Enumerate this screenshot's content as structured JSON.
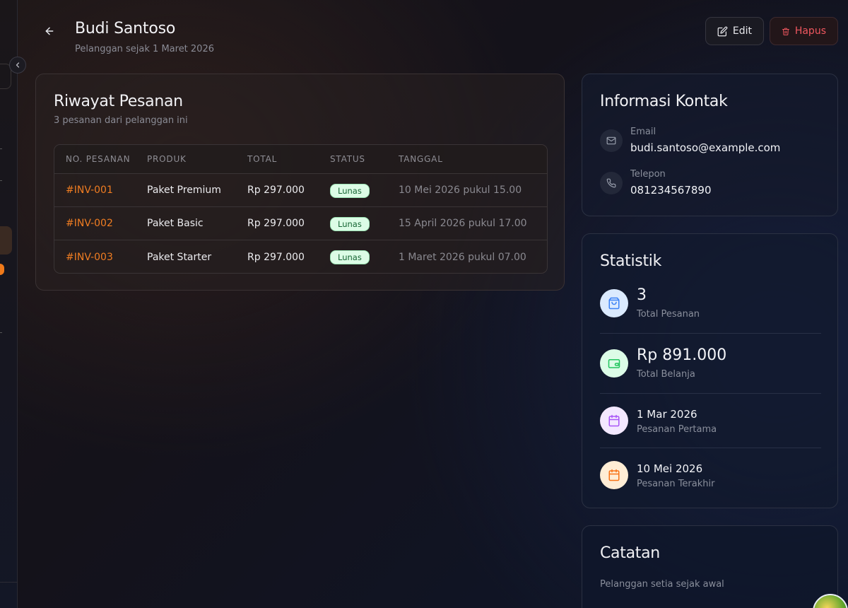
{
  "header": {
    "title": "Budi Santoso",
    "subtitle": "Pelanggan sejak 1 Maret 2026",
    "edit_label": "Edit",
    "delete_label": "Hapus"
  },
  "orders": {
    "title": "Riwayat Pesanan",
    "description": "3 pesanan dari pelanggan ini",
    "columns": [
      "NO. PESANAN",
      "PRODUK",
      "TOTAL",
      "STATUS",
      "TANGGAL"
    ],
    "rows": [
      {
        "id": "#INV-001",
        "product": "Paket Premium",
        "total": "Rp 297.000",
        "status": "Lunas",
        "date": "10 Mei 2026 pukul 15.00"
      },
      {
        "id": "#INV-002",
        "product": "Paket Basic",
        "total": "Rp 297.000",
        "status": "Lunas",
        "date": "15 April 2026 pukul 17.00"
      },
      {
        "id": "#INV-003",
        "product": "Paket Starter",
        "total": "Rp 297.000",
        "status": "Lunas",
        "date": "1 Maret 2026 pukul 07.00"
      }
    ]
  },
  "contact": {
    "title": "Informasi Kontak",
    "email_label": "Email",
    "email": "budi.santoso@example.com",
    "phone_label": "Telepon",
    "phone": "081234567890"
  },
  "stats": {
    "title": "Statistik",
    "items": [
      {
        "value": "3",
        "label": "Total Pesanan",
        "icon": "shopping-bag-icon",
        "color": "#3b82f6"
      },
      {
        "value": "Rp 891.000",
        "label": "Total Belanja",
        "icon": "wallet-icon",
        "color": "#22c55e"
      },
      {
        "value": "1 Mar 2026",
        "label": "Pesanan Pertama",
        "icon": "calendar-icon",
        "color": "#a855f7"
      },
      {
        "value": "10 Mei 2026",
        "label": "Pesanan Terakhir",
        "icon": "calendar-icon",
        "color": "#f97316"
      }
    ]
  },
  "notes": {
    "title": "Catatan",
    "text": "Pelanggan setia sejak awal"
  }
}
